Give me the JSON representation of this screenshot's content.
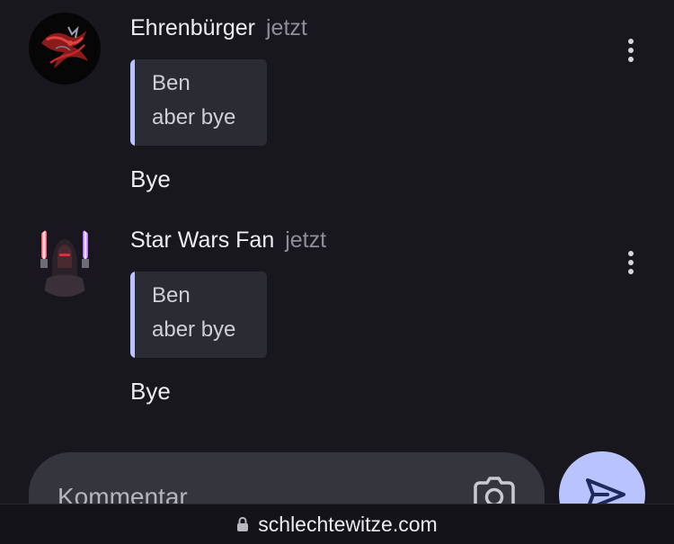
{
  "comments": [
    {
      "author": "Ehrenbürger",
      "time": "jetzt",
      "quote": {
        "author": "Ben",
        "text": "aber bye"
      },
      "text": "Bye"
    },
    {
      "author": "Star Wars Fan",
      "time": "jetzt",
      "quote": {
        "author": "Ben",
        "text": "aber bye"
      },
      "text": "Bye"
    }
  ],
  "composer": {
    "placeholder": "Kommentar",
    "camera_icon": "camera-icon",
    "send_icon": "send-icon"
  },
  "browser": {
    "url": "schlechtewitze.com",
    "lock_icon": "lock-icon"
  },
  "colors": {
    "background": "#17171d",
    "accent": "#b9c3ff",
    "quote_background": "#2b2b33",
    "composer_background": "#35353d"
  }
}
